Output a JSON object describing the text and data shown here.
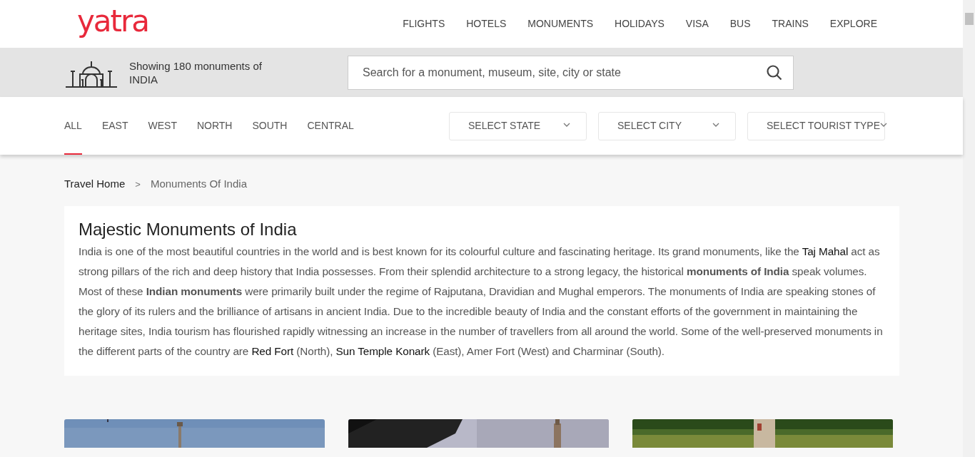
{
  "logo": "yatra",
  "nav": [
    "FLIGHTS",
    "HOTELS",
    "MONUMENTS",
    "HOLIDAYS",
    "VISA",
    "BUS",
    "TRAINS",
    "EXPLORE"
  ],
  "summary": {
    "text": "Showing 180 monuments of INDIA"
  },
  "search": {
    "placeholder": "Search for a monument, museum, site, city or state"
  },
  "region_tabs": [
    {
      "label": "ALL",
      "selected": true
    },
    {
      "label": "EAST",
      "selected": false
    },
    {
      "label": "WEST",
      "selected": false
    },
    {
      "label": "NORTH",
      "selected": false
    },
    {
      "label": "SOUTH",
      "selected": false
    },
    {
      "label": "CENTRAL",
      "selected": false
    }
  ],
  "dropdowns": [
    "SELECT STATE",
    "SELECT CITY",
    "SELECT TOURIST TYPE"
  ],
  "breadcrumb": {
    "items": [
      "Travel Home",
      "Monuments Of India"
    ],
    "separator": ">"
  },
  "intro": {
    "title": "Majestic Monuments of India",
    "segments": [
      {
        "kind": "text",
        "text": "India is one of the most beautiful countries in the world and is best known for its colourful culture and fascinating heritage. Its grand monuments, like the "
      },
      {
        "kind": "link",
        "text": "Taj Mahal"
      },
      {
        "kind": "text",
        "text": " act as strong pillars of the rich and deep history that India possesses. From their splendid architecture to a strong legacy, the historical "
      },
      {
        "kind": "bold",
        "text": "monuments of India"
      },
      {
        "kind": "text",
        "text": " speak volumes. Most of these "
      },
      {
        "kind": "bold",
        "text": "Indian monuments"
      },
      {
        "kind": "text",
        "text": " were primarily built under the regime of Rajputana, Dravidian and Mughal emperors. The monuments of India are speaking stones of the glory of its rulers and the brilliance of artisans in ancient India. Due to the incredible beauty of India and the constant efforts of the government in maintaining the heritage sites, India tourism has flourished rapidly witnessing an increase in the number of travellers from all around the world. Some of the well-preserved monuments in the different parts of the country are "
      },
      {
        "kind": "link",
        "text": "Red Fort"
      },
      {
        "kind": "text",
        "text": " (North), "
      },
      {
        "kind": "link",
        "text": "Sun Temple Konark"
      },
      {
        "kind": "text",
        "text": " (East), Amer Fort (West) and Charminar (South)."
      }
    ]
  }
}
